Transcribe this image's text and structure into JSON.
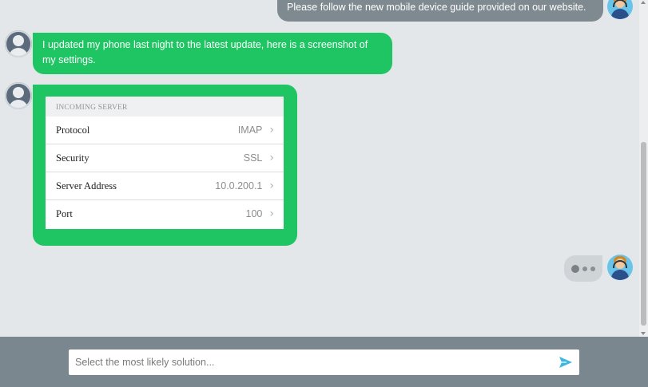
{
  "agent_message": "Please follow the new mobile device guide provided on our website.",
  "user_message": "I updated my phone last night to the latest update, here is a screenshot of my settings.",
  "settings_screenshot": {
    "header": "INCOMING SERVER",
    "rows": [
      {
        "label": "Protocol",
        "value": "IMAP"
      },
      {
        "label": "Security",
        "value": "SSL"
      },
      {
        "label": "Server Address",
        "value": "10.0.200.1"
      },
      {
        "label": "Port",
        "value": "100"
      }
    ]
  },
  "composer": {
    "placeholder": "Select the most likely solution..."
  },
  "icons": {
    "send": "send-icon",
    "chevron": "chevron-right-icon",
    "user_avatar": "user-avatar-icon",
    "agent_avatar": "agent-avatar-icon"
  },
  "colors": {
    "user_bubble": "#1fc463",
    "agent_bubble": "#7f8a90",
    "footer": "#7a878e",
    "send": "#3db7e0"
  }
}
